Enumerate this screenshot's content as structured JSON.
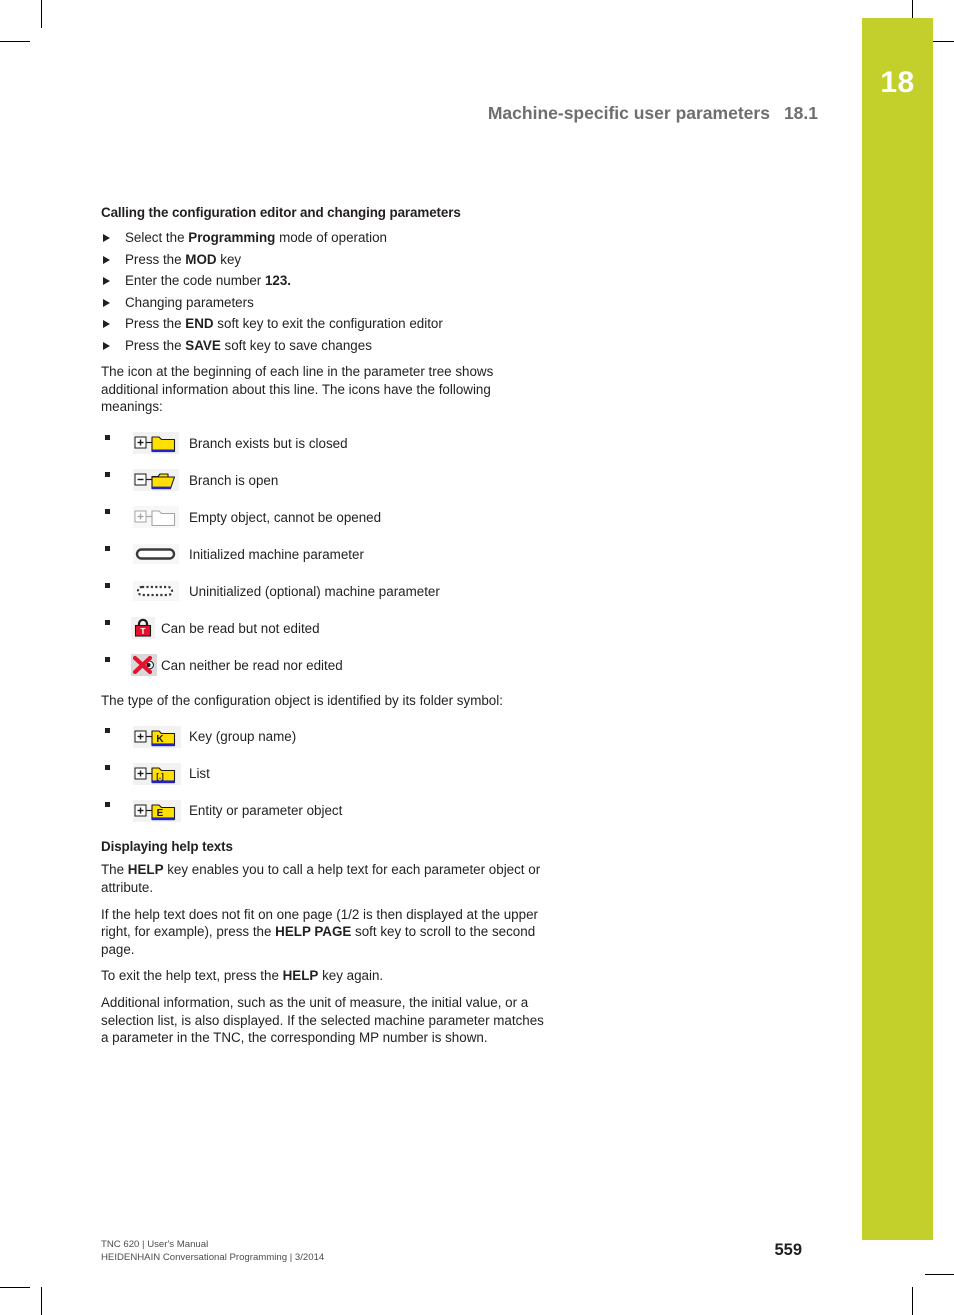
{
  "chapter": {
    "tab_number": "18",
    "accent_color": "#c3d02b"
  },
  "header": {
    "title": "Machine-specific user parameters",
    "section": "18.1"
  },
  "sections": {
    "calling_editor": {
      "heading": "Calling the configuration editor and changing parameters",
      "steps": [
        {
          "pre": "Select the ",
          "bold": "Programming",
          "post": " mode of operation"
        },
        {
          "pre": "Press the ",
          "bold": "MOD",
          "post": " key"
        },
        {
          "pre": "Enter the code number ",
          "bold": "123.",
          "post": ""
        },
        {
          "pre": "Changing parameters",
          "bold": "",
          "post": ""
        },
        {
          "pre": "Press the ",
          "bold": "END",
          "post": " soft key to exit the configuration editor"
        },
        {
          "pre": "Press the ",
          "bold": "SAVE",
          "post": " soft key to save changes"
        }
      ],
      "intro_paragraph": "The icon at the beginning of each line in the parameter tree shows additional information about this line. The icons have the following meanings:",
      "icon_items": [
        {
          "icon": "folder-closed-plus-icon",
          "label": "Branch exists but is closed"
        },
        {
          "icon": "folder-open-minus-icon",
          "label": "Branch is open"
        },
        {
          "icon": "folder-empty-plus-icon",
          "label": "Empty object, cannot be opened"
        },
        {
          "icon": "parameter-initialized-icon",
          "label": "Initialized machine parameter"
        },
        {
          "icon": "parameter-uninitialized-icon",
          "label": "Uninitialized (optional) machine parameter"
        },
        {
          "icon": "padlock-icon",
          "label": "Can be read but not edited"
        },
        {
          "icon": "no-access-icon",
          "label": "Can neither be read nor edited"
        }
      ],
      "folder_paragraph": "The type of the configuration object is identified by its folder symbol:",
      "folder_items": [
        {
          "icon": "folder-key-icon",
          "glyph": "K",
          "label": "Key (group name)"
        },
        {
          "icon": "folder-list-icon",
          "glyph": "[.]",
          "label": "List"
        },
        {
          "icon": "folder-entity-icon",
          "glyph": "E",
          "label": "Entity or parameter object"
        }
      ]
    },
    "help_texts": {
      "heading": "Displaying help texts",
      "paragraphs": [
        {
          "parts": [
            {
              "text": "The ",
              "bold": false
            },
            {
              "text": "HELP",
              "bold": true
            },
            {
              "text": " key enables you to call a help text for each parameter object or attribute.",
              "bold": false
            }
          ]
        },
        {
          "parts": [
            {
              "text": "If the help text does not fit on one page (1/2 is then displayed at the upper right, for example), press the ",
              "bold": false
            },
            {
              "text": "HELP PAGE",
              "bold": true
            },
            {
              "text": " soft key to scroll to the second page.",
              "bold": false
            }
          ]
        },
        {
          "parts": [
            {
              "text": "To exit the help text, press the ",
              "bold": false
            },
            {
              "text": "HELP",
              "bold": true
            },
            {
              "text": " key again.",
              "bold": false
            }
          ]
        },
        {
          "parts": [
            {
              "text": "Additional information, such as the unit of measure, the initial value, or a selection list, is also displayed. If the selected machine parameter matches a parameter in the TNC, the corresponding MP number is shown.",
              "bold": false
            }
          ]
        }
      ]
    }
  },
  "footer": {
    "line1": "TNC 620 | User's Manual",
    "line2": "HEIDENHAIN Conversational Programming | 3/2014",
    "page_number": "559"
  }
}
